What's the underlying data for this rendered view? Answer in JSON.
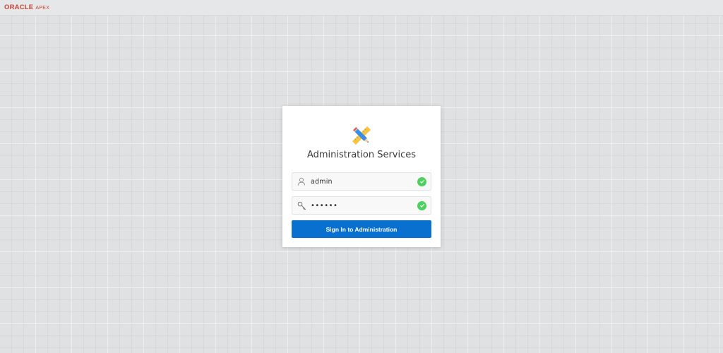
{
  "header": {
    "logo_oracle": "ORACLE",
    "logo_apex": "APEX"
  },
  "login": {
    "title": "Administration Services",
    "username": {
      "value": "admin",
      "icon": "user-icon",
      "status": "valid"
    },
    "password": {
      "masked_value": "••••••",
      "icon": "key-icon",
      "status": "valid"
    },
    "submit_label": "Sign In to Administration"
  },
  "colors": {
    "brand_red": "#c74634",
    "primary_button": "#0a70cf",
    "valid_check": "#4bd15d",
    "background": "#dfe1e3"
  }
}
